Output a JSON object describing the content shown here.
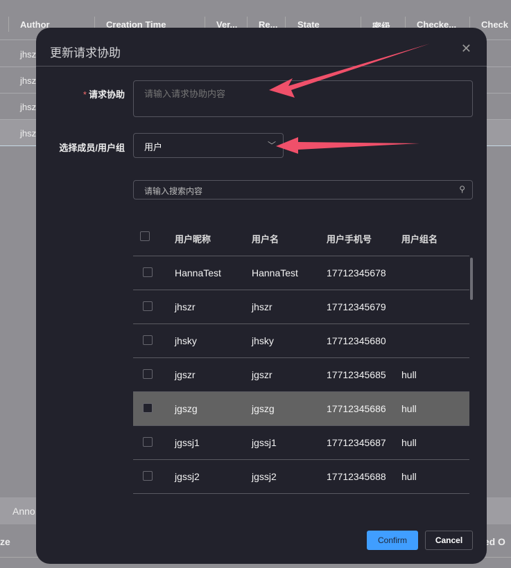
{
  "background": {
    "columns": [
      "Author",
      "Creation Time",
      "Ver...",
      "Re...",
      "State",
      "密级",
      "Checke...",
      "Check"
    ],
    "rows": [
      "jhsz",
      "jhsz",
      "jhsz",
      "jhsz"
    ],
    "band_label": "Anno",
    "footer_left": "ze",
    "footer_right": "ked O"
  },
  "dialog": {
    "title": "更新请求协助",
    "close_icon": "close-icon",
    "request_label": "请求协助",
    "request_required": "*",
    "request_placeholder": "请输入请求协助内容",
    "member_label": "选择成员/用户组",
    "member_value": "用户",
    "search_placeholder": "请输入搜索内容",
    "table": {
      "headers": [
        "用户昵称",
        "用户名",
        "用户手机号",
        "用户组名"
      ],
      "rows": [
        {
          "nickname": "HannaTest",
          "username": "HannaTest",
          "phone": "17712345678",
          "group": ""
        },
        {
          "nickname": "jhszr",
          "username": "jhszr",
          "phone": "17712345679",
          "group": ""
        },
        {
          "nickname": "jhsky",
          "username": "jhsky",
          "phone": "17712345680",
          "group": ""
        },
        {
          "nickname": "jgszr",
          "username": "jgszr",
          "phone": "17712345685",
          "group": "hull"
        },
        {
          "nickname": "jgszg",
          "username": "jgszg",
          "phone": "17712345686",
          "group": "hull"
        },
        {
          "nickname": "jgssj1",
          "username": "jgssj1",
          "phone": "17712345687",
          "group": "hull"
        },
        {
          "nickname": "jgssj2",
          "username": "jgssj2",
          "phone": "17712345688",
          "group": "hull"
        }
      ]
    },
    "confirm": "Confirm",
    "cancel": "Cancel"
  },
  "colors": {
    "accent": "#409eff",
    "arrow": "#f0506a",
    "dialog_bg": "#22222c"
  }
}
